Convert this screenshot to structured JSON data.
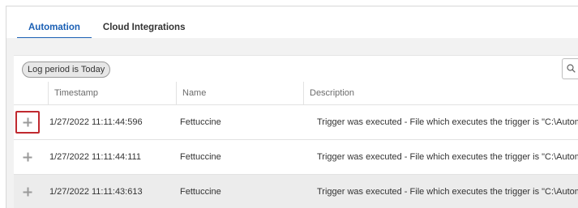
{
  "tabs": [
    {
      "label": "Automation",
      "active": true
    },
    {
      "label": "Cloud Integrations",
      "active": false
    }
  ],
  "toolbar": {
    "filter_chip": "Log period is Today",
    "search_icon": "search-icon"
  },
  "grid": {
    "columns": [
      "Timestamp",
      "Name",
      "Description"
    ],
    "rows": [
      {
        "timestamp": "1/27/2022 11:11:44:596",
        "name": "Fettuccine",
        "description": "Trigger was executed - File which executes the trigger is \"C:\\Automat",
        "highlighted": true
      },
      {
        "timestamp": "1/27/2022 11:11:44:111",
        "name": "Fettuccine",
        "description": "Trigger was executed - File which executes the trigger is \"C:\\Automat",
        "highlighted": false
      },
      {
        "timestamp": "1/27/2022 11:11:43:613",
        "name": "Fettuccine",
        "description": "Trigger was executed - File which executes the trigger is \"C:\\Automat",
        "highlighted": false
      }
    ]
  },
  "colors": {
    "accent": "#1a5fb4",
    "highlight_border": "#c0292f",
    "alt_row": "#ececec"
  }
}
